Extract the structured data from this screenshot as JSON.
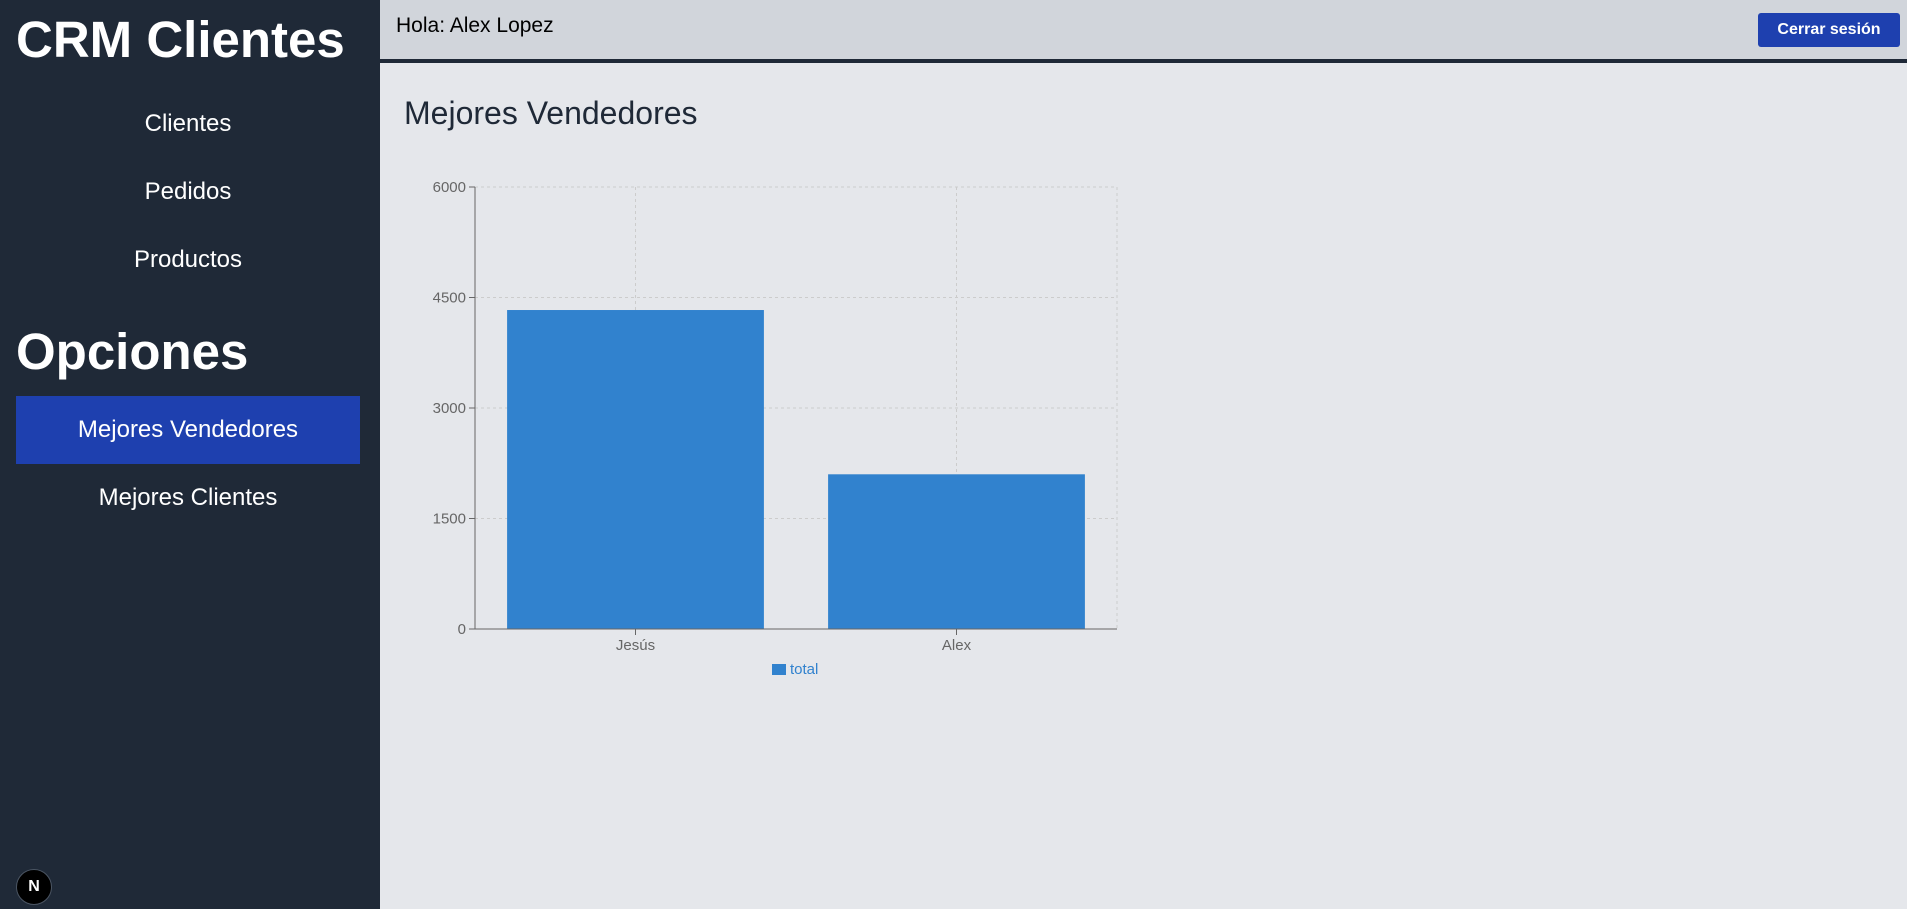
{
  "sidebar": {
    "brand": "CRM Clientes",
    "nav": [
      {
        "label": "Clientes"
      },
      {
        "label": "Pedidos"
      },
      {
        "label": "Productos"
      }
    ],
    "section_title": "Opciones",
    "options": [
      {
        "label": "Mejores Vendedores",
        "active": true
      },
      {
        "label": "Mejores Clientes",
        "active": false
      }
    ],
    "badge": "N"
  },
  "header": {
    "greeting": "Hola: Alex Lopez",
    "logout_label": "Cerrar sesión"
  },
  "main": {
    "title": "Mejores Vendedores"
  },
  "colors": {
    "sidebar_bg": "#1f2937",
    "accent": "#1e40af",
    "bar": "#3182ce"
  },
  "chart_data": {
    "type": "bar",
    "categories": [
      "Jesús",
      "Alex"
    ],
    "series": [
      {
        "name": "total",
        "values": [
          4330,
          2100
        ]
      }
    ],
    "yticks": [
      0,
      1500,
      3000,
      4500,
      6000
    ],
    "ylim": [
      0,
      6000
    ],
    "grid": true,
    "legend": "bottom"
  }
}
